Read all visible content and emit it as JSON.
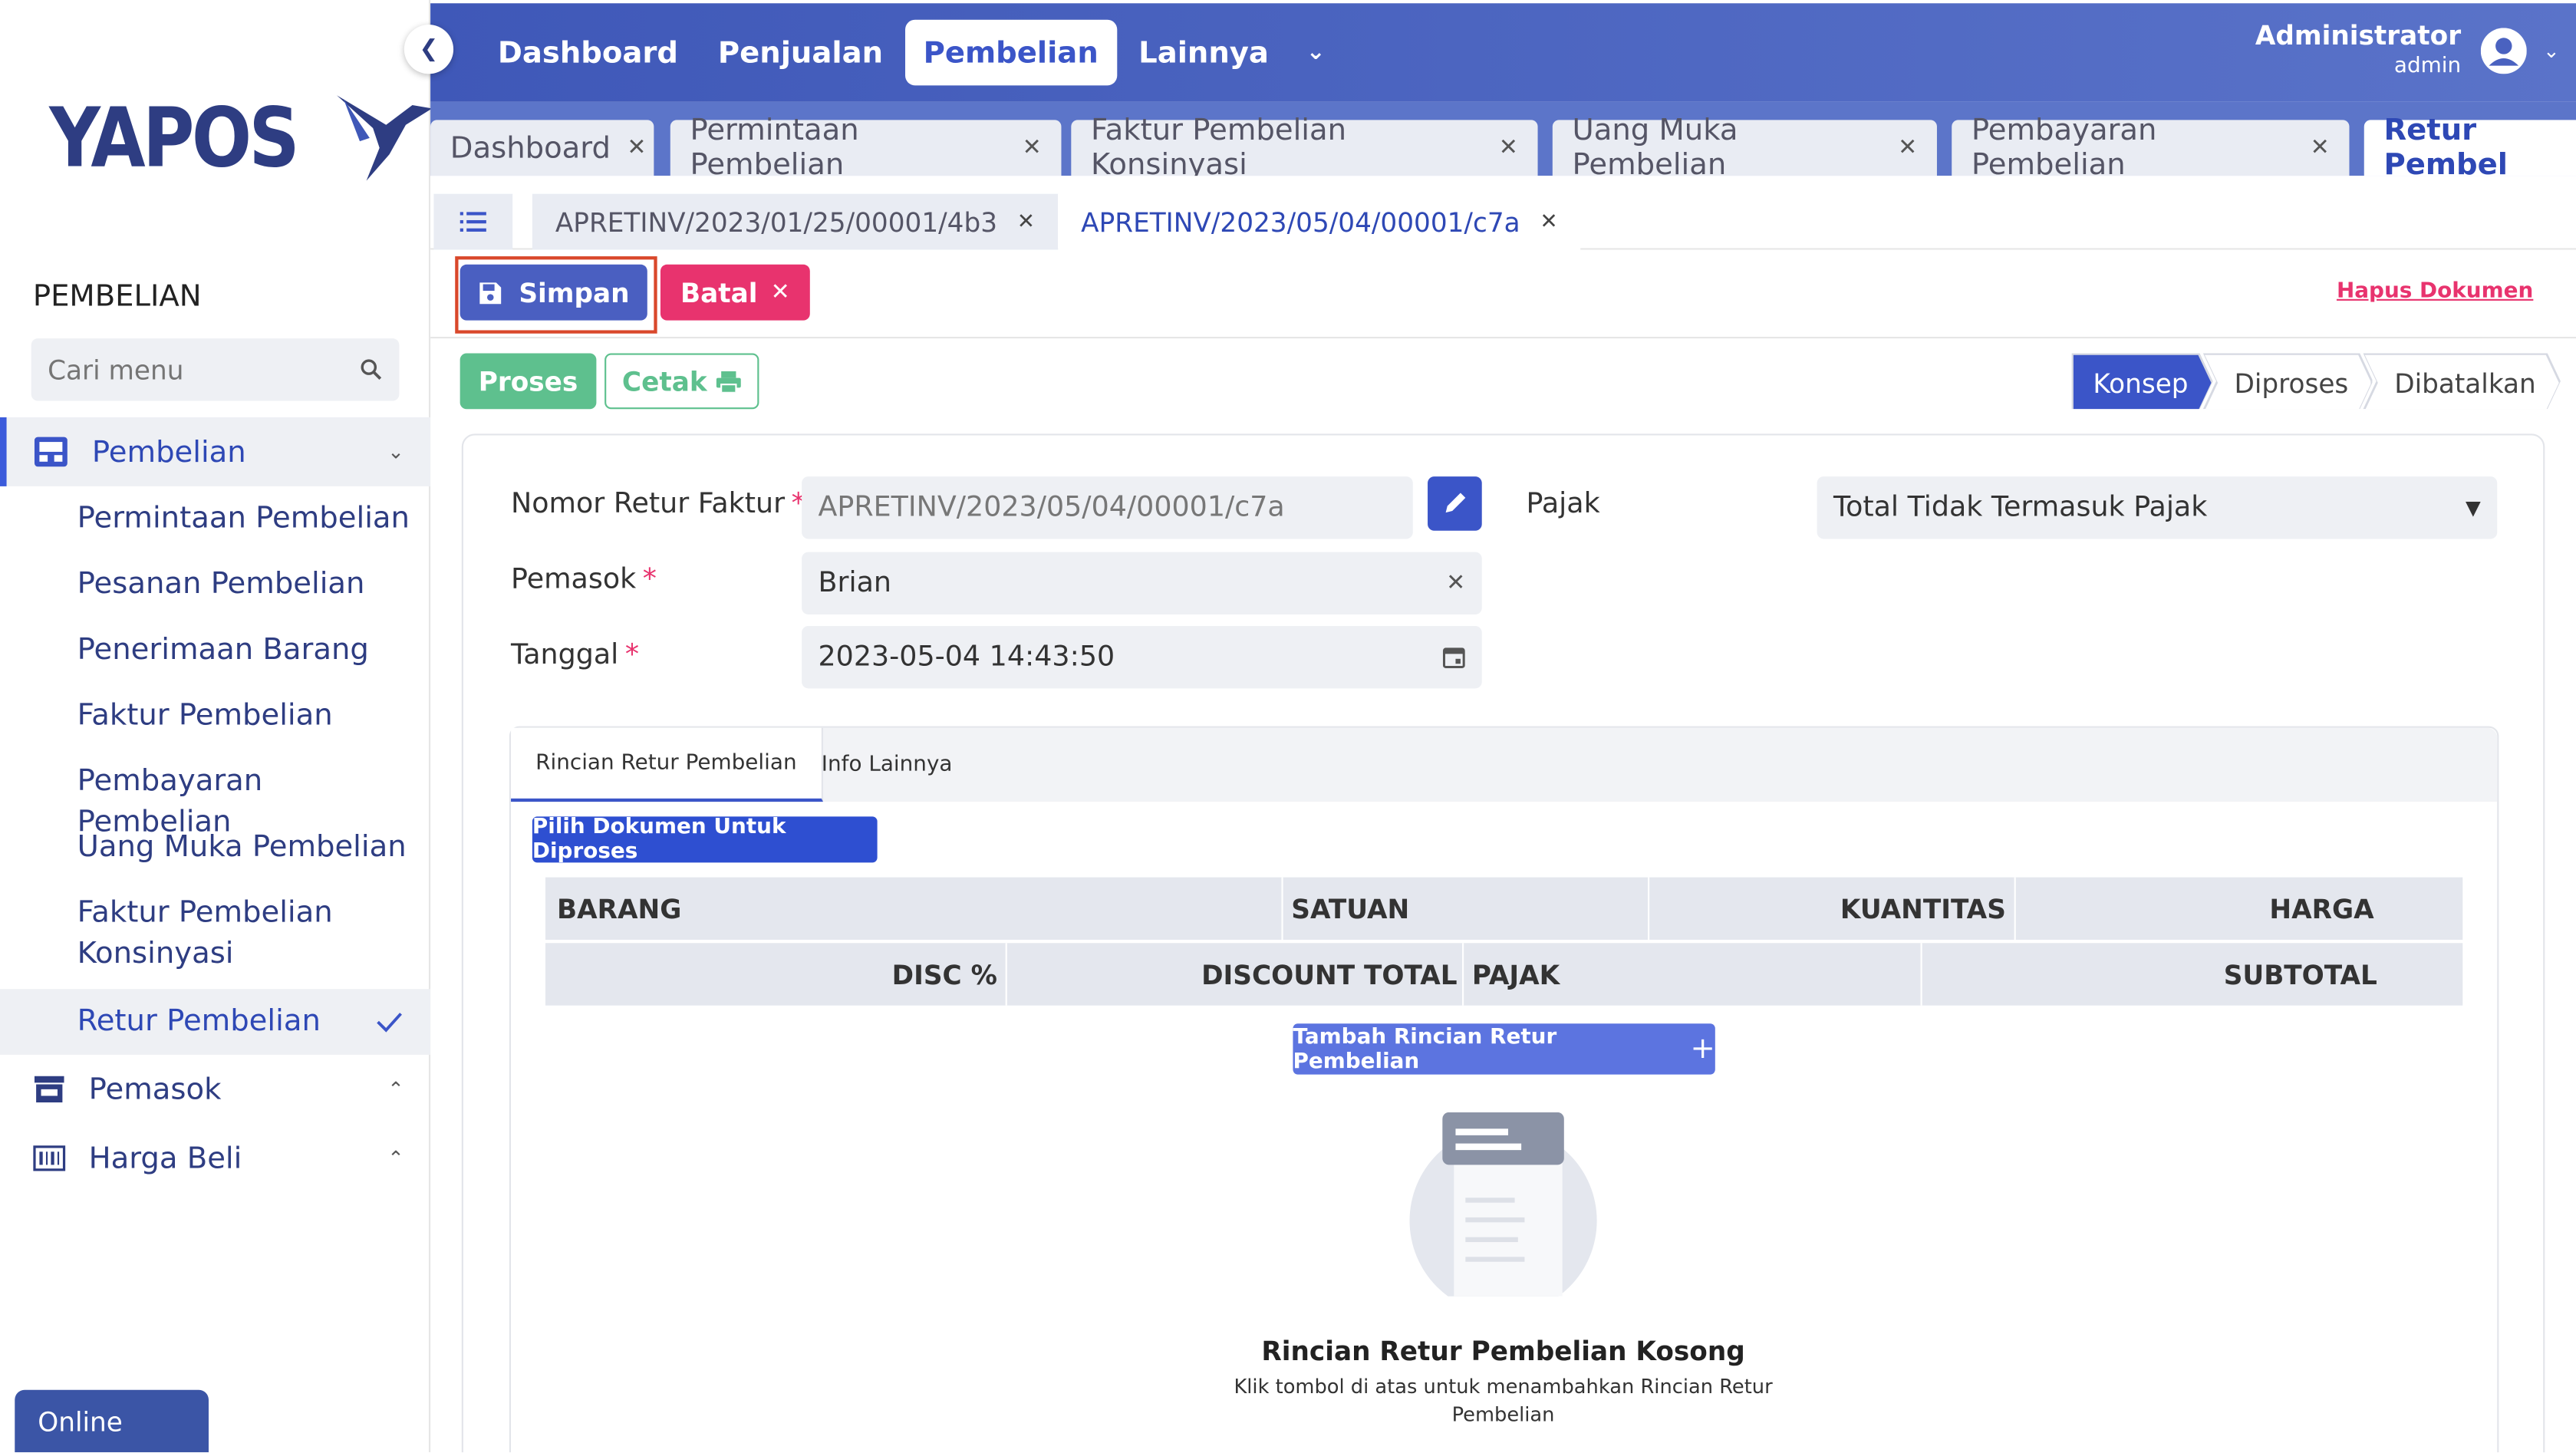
{
  "app": {
    "logo_text": "YAPOS",
    "brand_color": "#2e3d82",
    "accent_color": "#3b55c8"
  },
  "sidebar": {
    "section_title": "PEMBELIAN",
    "search_placeholder": "Cari menu",
    "groups": [
      {
        "label": "Pembelian",
        "icon": "inbox-icon",
        "expanded": true
      },
      {
        "label": "Pemasok",
        "icon": "store-icon",
        "expanded": false
      },
      {
        "label": "Harga Beli",
        "icon": "barcode-icon",
        "expanded": false
      }
    ],
    "sub_items": [
      "Permintaan Pembelian",
      "Pesanan Pembelian",
      "Penerimaan Barang",
      "Faktur Pembelian",
      "Pembayaran Pembelian",
      "Uang Muka Pembelian",
      "Faktur Pembelian Konsinyasi",
      "Retur Pembelian"
    ],
    "selected_sub_item": "Retur Pembelian",
    "status_button": "Online"
  },
  "topbar": {
    "tabs": [
      "Dashboard",
      "Penjualan",
      "Pembelian",
      "Lainnya"
    ],
    "active_tab": "Pembelian",
    "user_name": "Administrator",
    "user_role": "admin"
  },
  "doc_tabs": {
    "items": [
      "Dashboard",
      "Permintaan Pembelian",
      "Faktur Pembelian Konsinyasi",
      "Uang Muka Pembelian",
      "Pembayaran Pembelian",
      "Retur Pembel"
    ],
    "active": "Retur Pembel"
  },
  "record_tabs": {
    "items": [
      "APRETINV/2023/01/25/00001/4b3",
      "APRETINV/2023/05/04/00001/c7a"
    ],
    "active": "APRETINV/2023/05/04/00001/c7a"
  },
  "toolbar": {
    "save_label": "Simpan",
    "cancel_label": "Batal",
    "delete_link": "Hapus Dokumen"
  },
  "actions": {
    "process_label": "Proses",
    "print_label": "Cetak"
  },
  "status_steps": [
    "Konsep",
    "Diproses",
    "Dibatalkan"
  ],
  "status_active": "Konsep",
  "form": {
    "nomor_label": "Nomor Retur Faktur",
    "nomor_value": "APRETINV/2023/05/04/00001/c7a",
    "pemasok_label": "Pemasok",
    "pemasok_value": "Brian",
    "tanggal_label": "Tanggal",
    "tanggal_value": "2023-05-04  14:43:50",
    "pajak_label": "Pajak",
    "pajak_value": "Total Tidak Termasuk Pajak",
    "required_mark": "*"
  },
  "detail": {
    "tabs": [
      "Rincian Retur Pembelian",
      "Info Lainnya"
    ],
    "active_tab": "Rincian Retur Pembelian",
    "pick_button": "Pilih Dokumen Untuk Diproses",
    "header_row1": [
      "BARANG",
      "SATUAN",
      "KUANTITAS",
      "HARGA"
    ],
    "header_row2": [
      "DISC %",
      "DISCOUNT TOTAL",
      "PAJAK",
      "SUBTOTAL"
    ],
    "add_button": "Tambah Rincian Retur Pembelian",
    "empty_title": "Rincian Retur Pembelian Kosong",
    "empty_subtitle": "Klik tombol di atas untuk menambahkan Rincian Retur Pembelian"
  }
}
